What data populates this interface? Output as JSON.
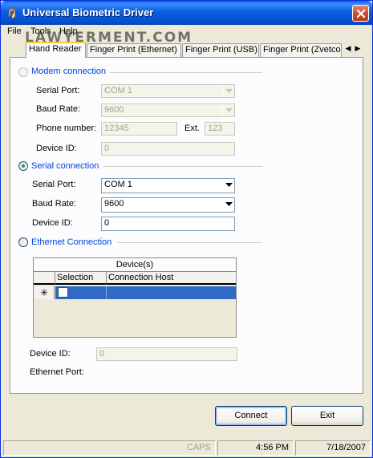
{
  "window": {
    "title": "Universal Biometric Driver"
  },
  "menu": {
    "items": [
      "File",
      "Tools",
      "Help"
    ]
  },
  "watermark": "LAWYERMENT.COM",
  "tabs": [
    "Hand Reader",
    "Finger Print (Ethernet)",
    "Finger Print (USB)",
    "Finger Print (Zvetco"
  ],
  "active_tab": "Hand Reader",
  "modem": {
    "label": "Modem connection",
    "selected": false,
    "serial_port_label": "Serial Port:",
    "serial_port_value": "COM 1",
    "baud_rate_label": "Baud Rate:",
    "baud_rate_value": "9600",
    "phone_label": "Phone number:",
    "phone_value": "12345",
    "ext_label": "Ext.",
    "ext_value": "123",
    "device_id_label": "Device ID:",
    "device_id_value": "0"
  },
  "serial": {
    "label": "Serial connection",
    "selected": true,
    "serial_port_label": "Serial Port:",
    "serial_port_value": "COM 1",
    "baud_rate_label": "Baud Rate:",
    "baud_rate_value": "9600",
    "device_id_label": "Device ID:",
    "device_id_value": "0"
  },
  "ethernet": {
    "label": "Ethernet Connection",
    "selected": false,
    "grid_title": "Device(s)",
    "columns": [
      "Selection",
      "Connection Host"
    ],
    "new_row_marker": "✳",
    "device_id_label": "Device ID:",
    "device_id_value": "0",
    "port_label": "Ethernet Port:"
  },
  "buttons": {
    "connect": "Connect",
    "exit": "Exit"
  },
  "status": {
    "caps": "CAPS",
    "time": "4:56 PM",
    "date": "7/18/2007"
  },
  "colors": {
    "group_label": "#0046d5",
    "titlebar": "#0552d4",
    "selection": "#316ac5"
  }
}
